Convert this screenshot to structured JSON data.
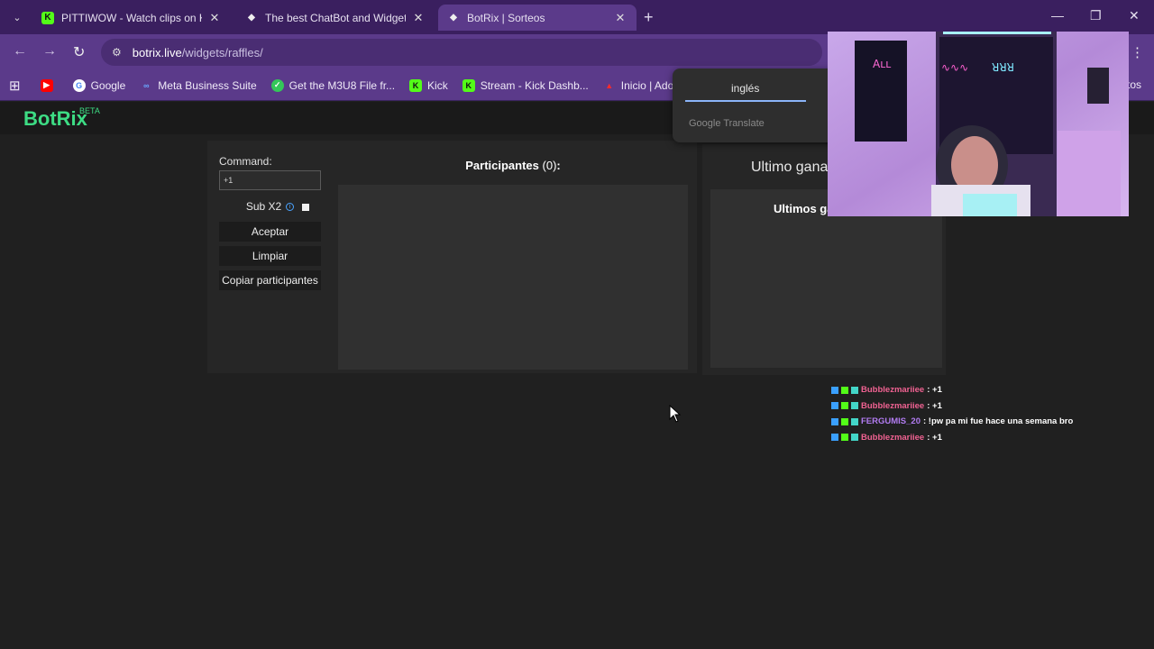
{
  "browser": {
    "tabs": [
      {
        "title": "PITTIWOW - Watch clips on Kick",
        "favicon": "kick-logo",
        "active": false
      },
      {
        "title": "The best ChatBot and Widgets f",
        "favicon": "botrix-logo",
        "active": false
      },
      {
        "title": "BotRix | Sorteos",
        "favicon": "botrix-logo",
        "active": true
      }
    ],
    "url_host": "botrix.live",
    "url_path": "/widgets/raffles/",
    "bookmarks": [
      {
        "label": "",
        "icon": "youtube-icon"
      },
      {
        "label": "Google",
        "icon": "google-icon"
      },
      {
        "label": "Meta Business Suite",
        "icon": "meta-icon"
      },
      {
        "label": "Get the M3U8 File fr...",
        "icon": "check-icon"
      },
      {
        "label": "Kick",
        "icon": "kick-icon"
      },
      {
        "label": "Stream - Kick Dashb...",
        "icon": "kick-icon"
      },
      {
        "label": "Inicio | Adobe",
        "icon": "adobe-icon"
      }
    ],
    "bookmarks_right": "tos"
  },
  "page": {
    "logo": "BotRix",
    "logo_badge": "BETA",
    "command_label": "Command:",
    "command_value": "+1",
    "sub_label": "Sub X2",
    "sub_checked": true,
    "buttons": {
      "accept": "Aceptar",
      "clear": "Limpiar",
      "copy": "Copiar participantes"
    },
    "participants_label": "Participantes",
    "participants_count": "(0)",
    "participants_colon": ":",
    "last_winner_label": "Ultimo gana",
    "last_winners_label": "Ultimos ga"
  },
  "translate_popup": {
    "language": "inglés",
    "provider": "Google Translate"
  },
  "chat": [
    {
      "user": "Bubblezmariiee",
      "message": ": +1",
      "color": "#f06292"
    },
    {
      "user": "Bubblezmariiee",
      "message": ": +1",
      "color": "#f06292"
    },
    {
      "user": "FERGUMIS_20",
      "message": ": !pw pa mi fue hace una semana bro",
      "color": "#b27cf2"
    },
    {
      "user": "Bubblezmariiee",
      "message": ": +1",
      "color": "#f06292"
    }
  ],
  "colors": {
    "accent_green": "#3ddc84",
    "browser_purple": "#5b3a8a"
  }
}
